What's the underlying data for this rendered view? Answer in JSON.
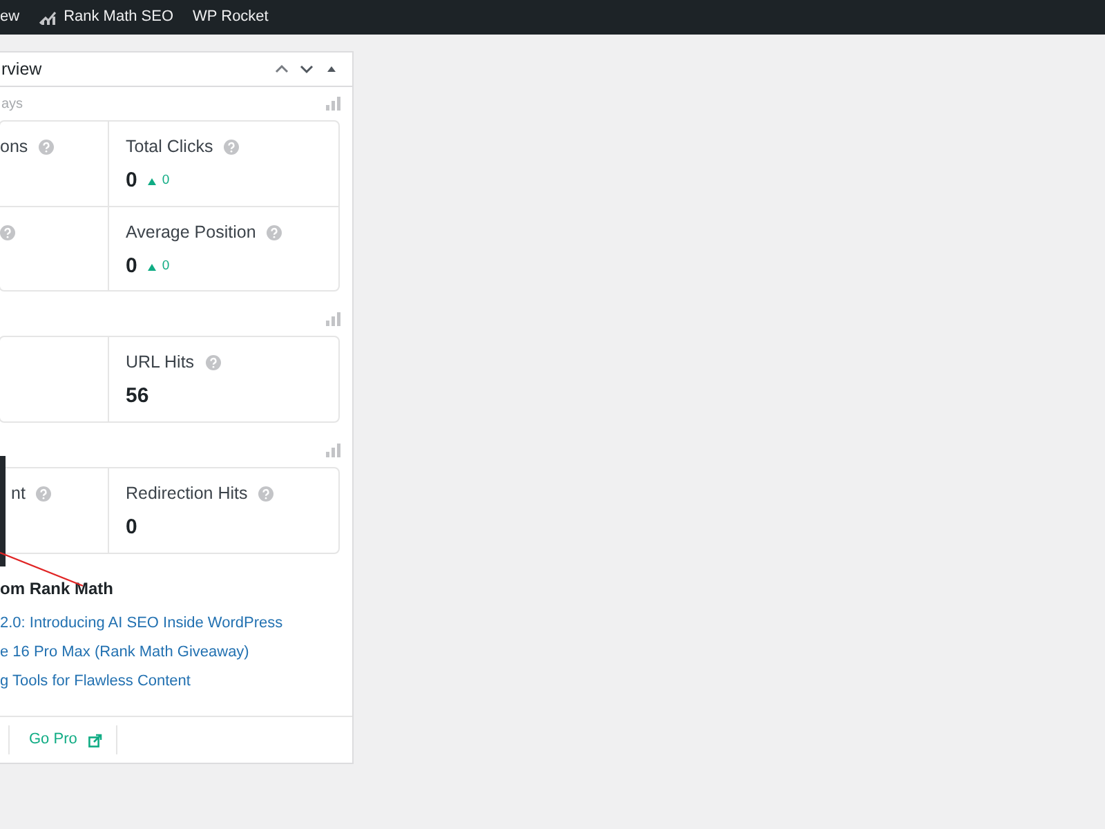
{
  "admin_bar": {
    "items": [
      {
        "label": "ew",
        "icon": false
      },
      {
        "label": "Rank Math SEO",
        "icon": true
      },
      {
        "label": "WP Rocket",
        "icon": false
      }
    ]
  },
  "widget": {
    "title": "rview",
    "sections": [
      {
        "label": "ays",
        "stats": [
          {
            "label": "ons",
            "help": true
          },
          {
            "label": "Total Clicks",
            "help": true,
            "value": "0",
            "change": "0"
          },
          {
            "help": true
          },
          {
            "label": "Average Position",
            "help": true,
            "value": "0",
            "change": "0"
          }
        ]
      },
      {
        "stats": [
          {
            "help": false
          },
          {
            "label": "URL Hits",
            "help": true,
            "value": "56"
          }
        ]
      },
      {
        "stats": [
          {
            "label": "nt",
            "help": true
          },
          {
            "label": "Redirection Hits",
            "help": true,
            "value": "0"
          }
        ]
      }
    ],
    "news": {
      "heading": "om Rank Math",
      "links": [
        "2.0: Introducing AI SEO Inside WordPress",
        "e 16 Pro Max (Rank Math Giveaway)",
        "g Tools for Flawless Content"
      ]
    },
    "footer": {
      "links": [
        {
          "label": "Go Pro",
          "external": true
        }
      ]
    }
  }
}
